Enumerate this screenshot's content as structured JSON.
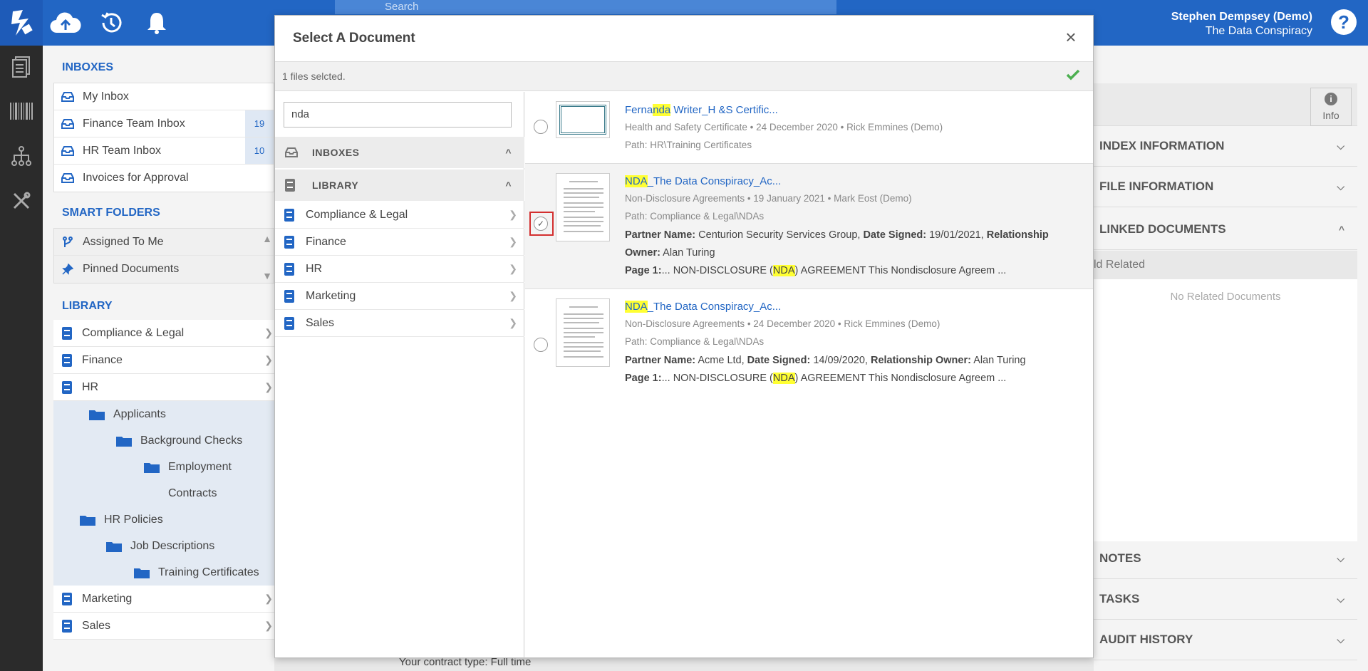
{
  "topbar": {
    "search_placeholder": "Search",
    "user_name": "Stephen Dempsey (Demo)",
    "org_name": "The Data Conspiracy",
    "help_label": "?"
  },
  "sidebar": {
    "inboxes_title": "INBOXES",
    "inboxes": [
      {
        "label": "My Inbox",
        "count": ""
      },
      {
        "label": "Finance Team Inbox",
        "count": "19"
      },
      {
        "label": "HR Team Inbox",
        "count": "10"
      },
      {
        "label": "Invoices for Approval",
        "count": ""
      }
    ],
    "smart_title": "SMART FOLDERS",
    "smart": [
      {
        "label": "Assigned To Me"
      },
      {
        "label": "Pinned Documents"
      }
    ],
    "library_title": "LIBRARY",
    "library": [
      {
        "label": "Compliance & Legal"
      },
      {
        "label": "Finance"
      },
      {
        "label": "HR"
      }
    ],
    "tree": [
      {
        "label": "Applicants"
      },
      {
        "label": "Background Checks"
      },
      {
        "label": "Employment"
      },
      {
        "label": "Contracts"
      },
      {
        "label": "HR Policies"
      },
      {
        "label": "Job Descriptions"
      },
      {
        "label": "Training Certificates"
      }
    ],
    "library_after": [
      {
        "label": "Marketing"
      },
      {
        "label": "Sales"
      }
    ]
  },
  "right_panel": {
    "info_label": "Info",
    "sections": {
      "index": "INDEX INFORMATION",
      "file": "FILE INFORMATION",
      "linked": "LINKED DOCUMENTS",
      "notes": "NOTES",
      "tasks": "TASKS",
      "audit": "AUDIT HISTORY"
    },
    "related_label": "ld Related",
    "empty_text": "No Related Documents"
  },
  "bottom_text": "Your contract type: Full time",
  "modal": {
    "title": "Select A Document",
    "close": "×",
    "status": "1 files selcted.",
    "search_value": "nda",
    "group_inboxes": "INBOXES",
    "group_library": "LIBRARY",
    "library_items": [
      "Compliance & Legal",
      "Finance",
      "HR",
      "Marketing",
      "Sales"
    ],
    "results": [
      {
        "title_pre": "Ferna",
        "title_hl": "nda",
        "title_post": " Writer_H &S Certific...",
        "meta": "Health and Safety Certificate • 24 December 2020 • Rick Emmines (Demo)",
        "path": "Path: HR\\Training Certificates",
        "selected": false
      },
      {
        "title_pre": "",
        "title_hl": "NDA",
        "title_post": "_The Data Conspiracy_Ac...",
        "meta": "Non-Disclosure Agreements • 19 January 2021 • Mark Eost (Demo)",
        "path": "Path: Compliance & Legal\\NDAs",
        "partner_label": "Partner Name:",
        "partner_value": " Centurion Security Services Group, ",
        "date_label": "Date Signed:",
        "date_value": " 19/01/2021, ",
        "owner_label": "Relationship Owner:",
        "owner_value": " Alan Turing",
        "page_label": "Page 1:",
        "page_pre": "... NON-DISCLOSURE (",
        "page_hl": "NDA",
        "page_post": ") AGREEMENT This Nondisclosure Agreem ...",
        "selected": true
      },
      {
        "title_pre": "",
        "title_hl": "NDA",
        "title_post": "_The Data Conspiracy_Ac...",
        "meta": "Non-Disclosure Agreements • 24 December 2020 • Rick Emmines (Demo)",
        "path": "Path: Compliance & Legal\\NDAs",
        "partner_label": "Partner Name:",
        "partner_value": " Acme Ltd, ",
        "date_label": "Date Signed:",
        "date_value": " 14/09/2020, ",
        "owner_label": "Relationship Owner:",
        "owner_value": " Alan Turing",
        "page_label": "Page 1:",
        "page_pre": "... NON-DISCLOSURE (",
        "page_hl": "NDA",
        "page_post": ") AGREEMENT This Nondisclosure Agreem ...",
        "selected": false
      }
    ]
  },
  "colors": {
    "brand_blue": "#2266c4",
    "rail": "#2b2b2b",
    "highlight": "#ffff33",
    "selected_frame": "#d32f2f",
    "confirm_green": "#4caf50"
  }
}
